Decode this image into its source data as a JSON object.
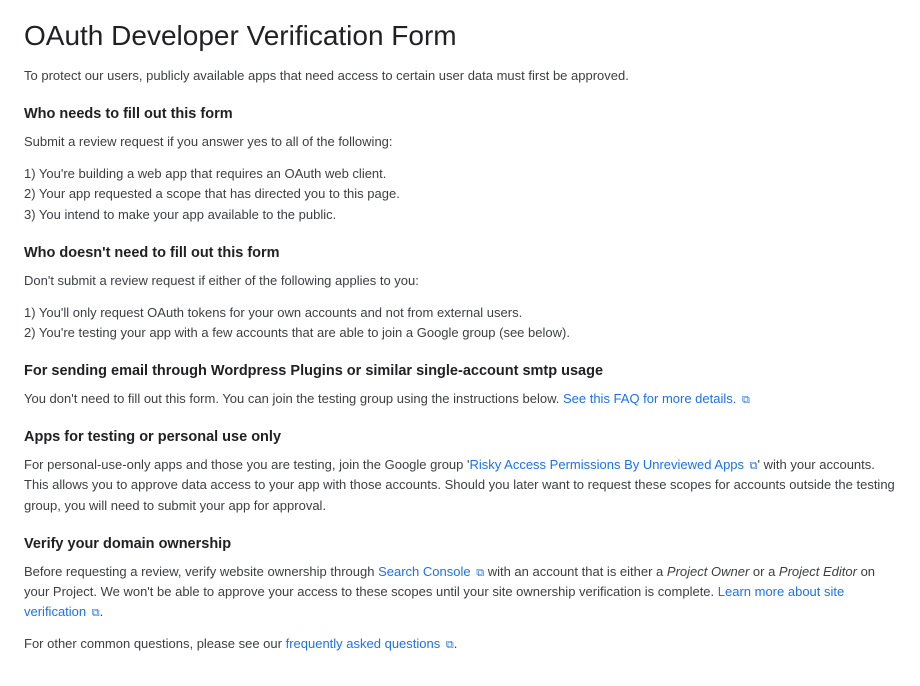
{
  "title": "OAuth Developer Verification Form",
  "intro": "To protect our users, publicly available apps that need access to certain user data must first be approved.",
  "sections": {
    "who_needs": {
      "heading": "Who needs to fill out this form",
      "lead": "Submit a review request if you answer yes to all of the following:",
      "items": {
        "i1": "1) You're building a web app that requires an OAuth web client.",
        "i2": "2) Your app requested a scope that has directed you to this page.",
        "i3": "3) You intend to make your app available to the public."
      }
    },
    "who_not": {
      "heading": "Who doesn't need to fill out this form",
      "lead": "Don't submit a review request if either of the following applies to you:",
      "items": {
        "i1": "1) You'll only request OAuth tokens for your own accounts and not from external users.",
        "i2": "2) You're testing your app with a few accounts that are able to join a Google group (see below)."
      }
    },
    "smtp": {
      "heading": "For sending email through Wordpress Plugins or similar single-account smtp usage",
      "text": "You don't need to fill out this form. You can join the testing group using the instructions below. ",
      "link": "See this FAQ for more details."
    },
    "testing": {
      "heading": "Apps for testing or personal use only",
      "text_before": "For personal-use-only apps and those you are testing, join the Google group '",
      "link": "Risky Access Permissions By Unreviewed Apps",
      "text_after": "' with your accounts. This allows you to approve data access to your app with those accounts. Should you later want to request these scopes for accounts outside the testing group, you will need to submit your app for approval."
    },
    "verify": {
      "heading": "Verify your domain ownership",
      "text_before": "Before requesting a review, verify website ownership through ",
      "link_console": "Search Console",
      "text_middle1": " with an account that is either a ",
      "owner": "Project Owner",
      "text_or": " or a ",
      "editor": "Project Editor",
      "text_middle2": " on your Project. We won't be able to approve your access to these scopes until your site ownership verification is complete. ",
      "link_learn": "Learn more about site verification",
      "period": "."
    },
    "faq": {
      "text_before": "For other common questions, please see our ",
      "link": "frequently asked questions",
      "period": "."
    }
  },
  "ext_icon": "⧉"
}
